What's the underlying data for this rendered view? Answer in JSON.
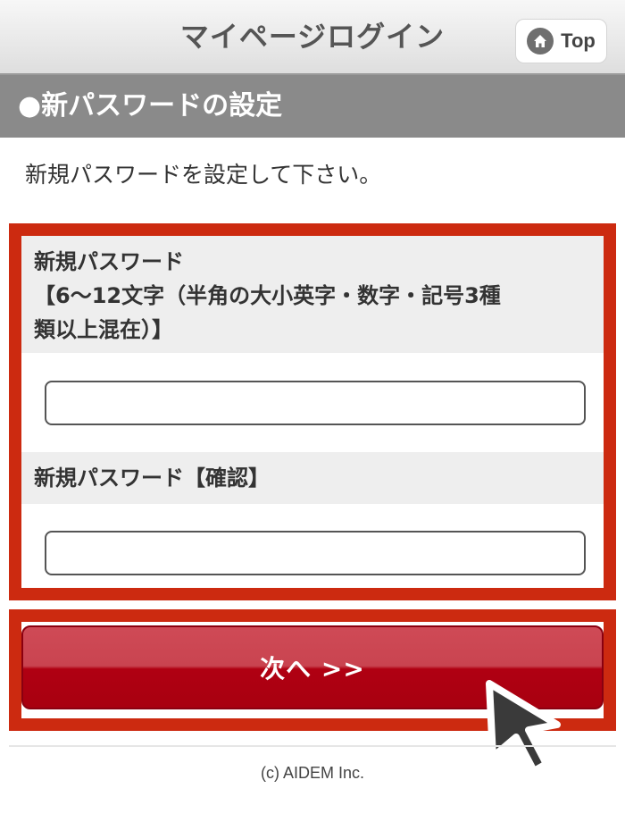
{
  "header": {
    "title": "マイページログイン",
    "top_button": {
      "label": "Top",
      "icon": "home-icon"
    }
  },
  "section": {
    "title": "●新パスワードの設定"
  },
  "instruction": "新規パスワードを設定して下さい。",
  "form": {
    "new_password": {
      "label_lines": [
        "新規パスワード",
        "【6～12文字（半角の大小英字・数字・記号3種",
        "類以上混在）】"
      ],
      "value": "",
      "placeholder": ""
    },
    "confirm_password": {
      "label": "新規パスワード【確認】",
      "value": "",
      "placeholder": ""
    }
  },
  "next_button": {
    "label": "次へ >>"
  },
  "footer": {
    "copyright": "(c) AIDEM Inc."
  },
  "colors": {
    "highlight_border": "#cc2a10",
    "button_top": "#c94450",
    "button_bottom": "#b00012",
    "section_bar": "#8a8a8a"
  }
}
